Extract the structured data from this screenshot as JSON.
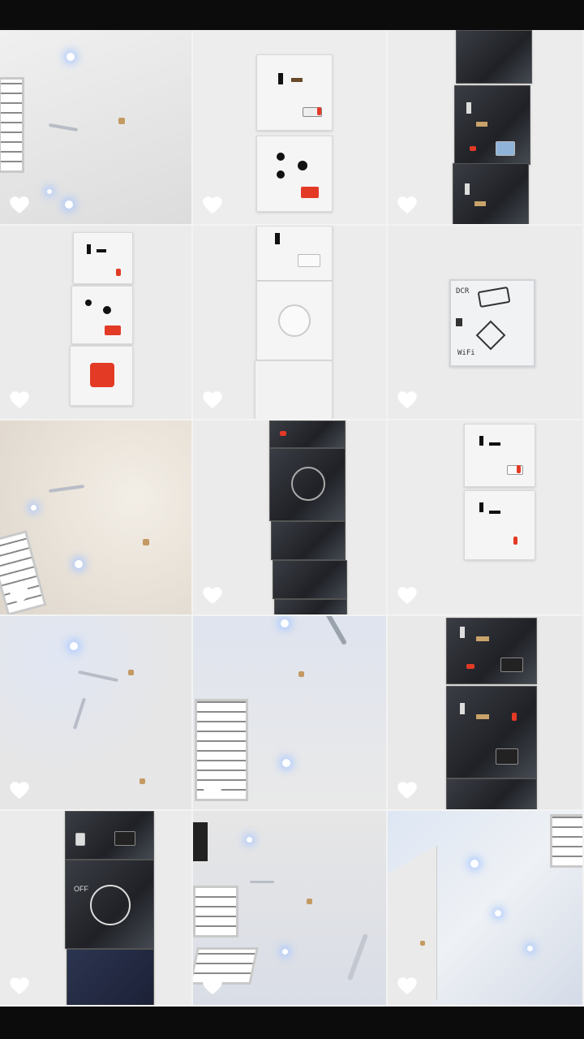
{
  "grid": {
    "cells": [
      {
        "id": "c1",
        "scene": "ceiling-fan-window",
        "liked": false
      },
      {
        "id": "c2",
        "scene": "white-socket-plates",
        "liked": false
      },
      {
        "id": "c3",
        "scene": "dark-socket-plates",
        "liked": false
      },
      {
        "id": "c4",
        "scene": "white-plates-red-switch",
        "liked": false
      },
      {
        "id": "c5",
        "scene": "white-fan-regulator",
        "liked": false
      },
      {
        "id": "c6",
        "scene": "sensor-panel",
        "liked": false
      },
      {
        "id": "c7",
        "scene": "ceiling-fan-curved",
        "liked": false
      },
      {
        "id": "c8",
        "scene": "dark-fan-regulator",
        "liked": false
      },
      {
        "id": "c9",
        "scene": "white-socket-pair",
        "liked": false
      },
      {
        "id": "c10",
        "scene": "ceiling-fan-lights",
        "liked": false
      },
      {
        "id": "c11",
        "scene": "room-window-fan",
        "liked": false
      },
      {
        "id": "c12",
        "scene": "dark-socket-pair",
        "liked": false
      },
      {
        "id": "c13",
        "scene": "dark-regulator-full",
        "liked": false
      },
      {
        "id": "c14",
        "scene": "room-fan-window",
        "liked": false
      },
      {
        "id": "c15",
        "scene": "ceiling-corner-lights",
        "liked": false
      }
    ]
  },
  "labels": {
    "sensor_top": "DCR",
    "sensor_bottom": "WiFi",
    "regulator_off": "OFF"
  },
  "icons": {
    "like": "heart-outline-icon"
  },
  "colors": {
    "background": "#0c0c0d",
    "accent_red": "#e33a26",
    "light_glow": "#aac8ff"
  }
}
